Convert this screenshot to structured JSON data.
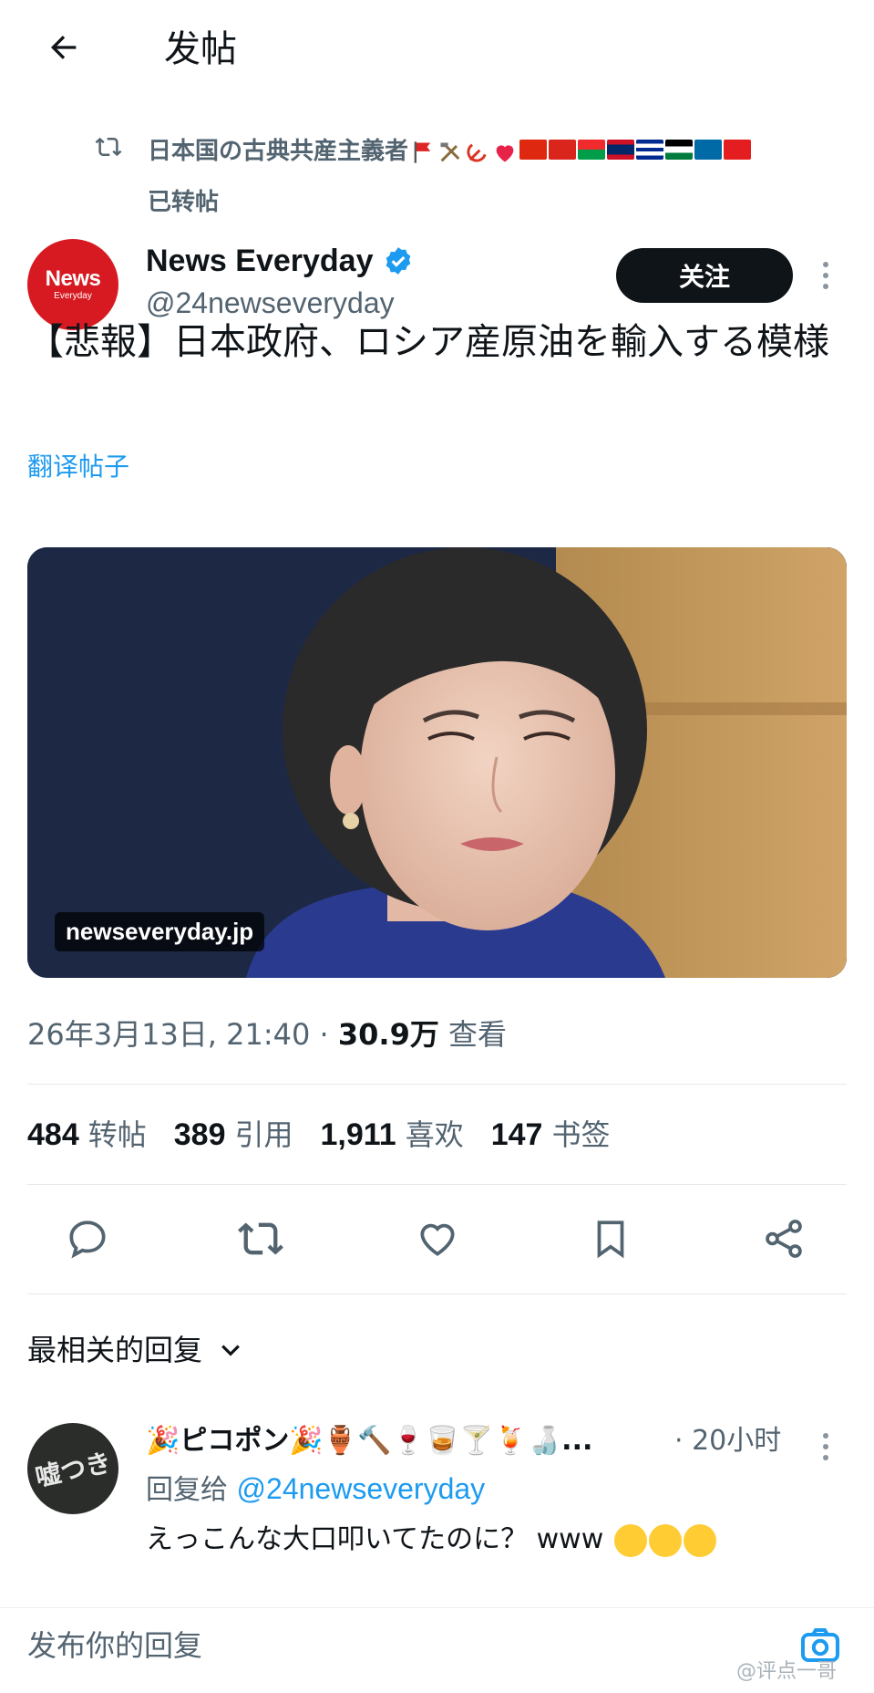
{
  "header": {
    "back_icon": "arrow-left-icon",
    "title": "发帖"
  },
  "repost": {
    "icon": "repost-icon",
    "reposter_name": "日本国の古典共産主義者",
    "reposter_name_emojis": [
      "red-flag",
      "hammer-pick",
      "hammer-sickle",
      "red-heart",
      "flag-china",
      "flag-vietnam",
      "flag-burkina-faso",
      "flag-laos",
      "flag-cuba",
      "flag-palestine",
      "flag-sweden",
      "flag-albania"
    ],
    "label": "已转帖"
  },
  "author": {
    "avatar_text_big": "News",
    "avatar_text_small": "Everyday",
    "name": "News Everyday",
    "verified_icon": "verified-badge-icon",
    "handle": "@24newseveryday",
    "follow_label": "关注",
    "more_icon": "more-vertical-icon"
  },
  "post": {
    "text": "【悲報】日本政府、ロシア産原油を輸入する模様",
    "translate_label": "翻译帖子",
    "image_caption": "newseveryday.jp",
    "timestamp": "26年3月13日, 21:40 · ",
    "views_count": "30.9万",
    "views_label": " 查看"
  },
  "stats": [
    {
      "count": "484",
      "label": "转帖"
    },
    {
      "count": "389",
      "label": "引用"
    },
    {
      "count": "1,911",
      "label": "喜欢"
    },
    {
      "count": "147",
      "label": "书签"
    }
  ],
  "actions": [
    "reply-icon",
    "repost-icon",
    "like-icon",
    "bookmark-icon",
    "share-icon"
  ],
  "replies": {
    "sort_label": "最相关的回复",
    "sort_icon": "chevron-down-icon",
    "items": [
      {
        "avatar_text": "嘘つき",
        "name": "🎉ピコポン🎉🏺🔨🍷🥃🍸🍹🍶...",
        "time": "· 20小时",
        "reply_to_label": "回复给 ",
        "reply_to_handle": "@24newseveryday",
        "text": "えっこんな大口叩いてたのに？ www"
      }
    ]
  },
  "composer": {
    "placeholder": "发布你的回复",
    "camera_icon": "camera-icon",
    "watermark": "@评点一哥"
  },
  "colors": {
    "accent": "#1d9bf0",
    "text": "#0f1419",
    "muted": "#536471",
    "brand_red": "#d71a21"
  }
}
